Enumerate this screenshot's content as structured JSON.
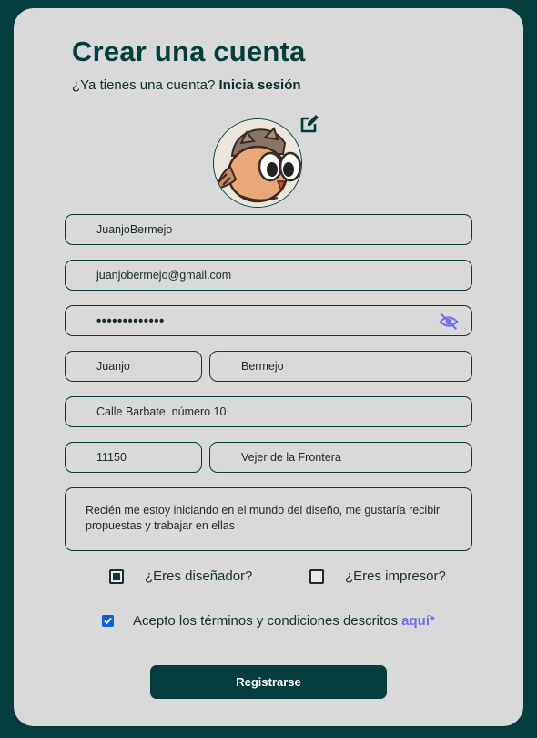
{
  "header": {
    "title": "Crear una cuenta",
    "subtitle_prefix": "¿Ya tienes una cuenta?",
    "login_link": "Inicia sesión"
  },
  "avatar": {
    "icon": "owl-cartoon-avatar"
  },
  "form": {
    "username": "JuanjoBermejo",
    "email": "juanjobermejo@gmail.com",
    "password_masked": "•••••••••••••",
    "first_name": "Juanjo",
    "last_name": "Bermejo",
    "address": "Calle Barbate, número 10",
    "postal_code": "11150",
    "city": "Vejer de la Frontera",
    "bio": "Recién me estoy iniciando en el mundo del diseño, me gustaría recibir propuestas y trabajar en ellas"
  },
  "options": {
    "designer_label": "¿Eres diseñador?",
    "designer_checked": true,
    "printer_label": "¿Eres impresor?",
    "printer_checked": false
  },
  "terms": {
    "label": "Acepto los términos y condiciones descritos",
    "link": "aquí*",
    "checked": true
  },
  "submit_label": "Registrarse",
  "colors": {
    "background": "#033d3e",
    "card": "#d9d9d9",
    "primary": "#033d3e",
    "link_accent": "#6d6df0",
    "checkbox_accent": "#0a63d1"
  }
}
